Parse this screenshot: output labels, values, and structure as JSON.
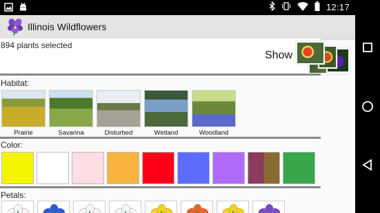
{
  "status_bar": {
    "time": "12:17",
    "left_icons": [
      "image-icon",
      "android-icon"
    ],
    "right_icons": [
      "bluetooth-icon",
      "vibrate-icon",
      "wifi-icon",
      "battery-icon"
    ]
  },
  "app_bar": {
    "title": "Illinois Wildflowers",
    "icon": "violet-flower-icon"
  },
  "summary": {
    "count_text": "894 plants selected",
    "show_label": "Show"
  },
  "sections": {
    "habitat_label": "Habitat:",
    "color_label": "Color:",
    "petals_label": "Petals:"
  },
  "habitats": [
    {
      "label": "Prairie"
    },
    {
      "label": "Savanna"
    },
    {
      "label": "Disturbed"
    },
    {
      "label": "Wetland"
    },
    {
      "label": "Woodland"
    }
  ],
  "colors": [
    "#f5f500",
    "#ffffff",
    "#ffdde5",
    "#f8b23e",
    "#ff0018",
    "#5c6cfd",
    "#b06bfb",
    "split-maroon-brown",
    "#3aa64c"
  ],
  "split_swatch": {
    "left": "#8a3b5e",
    "right": "#8a6a33"
  },
  "petals": [
    "white",
    "blue",
    "white",
    "white",
    "yellow",
    "orange",
    "yellow",
    "purple"
  ],
  "nav": {
    "buttons": [
      "recents-button",
      "home-button",
      "back-button"
    ]
  }
}
